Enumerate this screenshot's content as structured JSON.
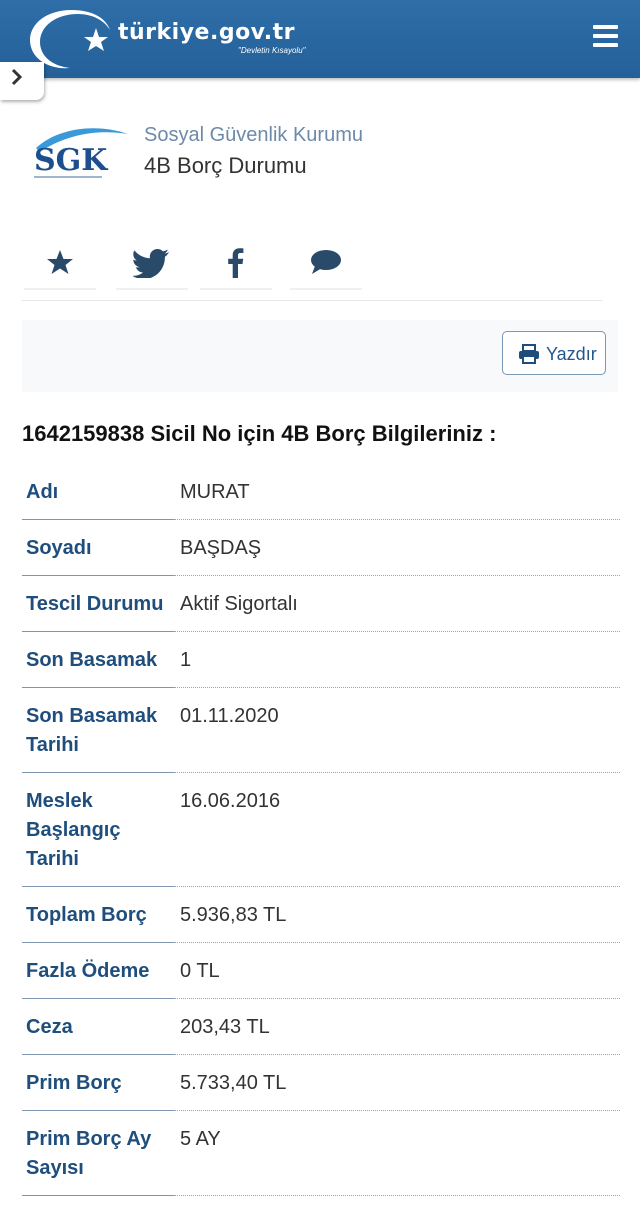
{
  "header": {
    "logo_text": "türkiye.gov.tr",
    "logo_slogan": "\"Devletin Kısayolu\""
  },
  "institution": {
    "logo_text": "SGK",
    "name": "Sosyal Güvenlik Kurumu",
    "service": "4B Borç Durumu"
  },
  "share": {
    "icons": [
      "star-icon",
      "twitter-icon",
      "facebook-icon",
      "comment-icon"
    ]
  },
  "toolbar": {
    "print_label": "Yazdır"
  },
  "info": {
    "title": "1642159838 Sicil No için 4B Borç Bilgileriniz :",
    "rows": [
      {
        "label": "Adı",
        "value": "MURAT"
      },
      {
        "label": "Soyadı",
        "value": "BAŞDAŞ"
      },
      {
        "label": "Tescil Durumu",
        "value": "Aktif Sigortalı"
      },
      {
        "label": "Son Basamak",
        "value": "1"
      },
      {
        "label": "Son Basamak Tarihi",
        "value": "01.11.2020"
      },
      {
        "label": "Meslek Başlangıç Tarihi",
        "value": "16.06.2016"
      },
      {
        "label": "Toplam Borç",
        "value": "5.936,83 TL"
      },
      {
        "label": "Fazla Ödeme",
        "value": "0 TL"
      },
      {
        "label": "Ceza",
        "value": "203,43 TL"
      },
      {
        "label": "Prim Borç",
        "value": "5.733,40 TL"
      },
      {
        "label": "Prim Borç Ay Sayısı",
        "value": "5 AY"
      }
    ]
  },
  "colors": {
    "header_bg": "#2a659f",
    "label_blue": "#1f4e7d",
    "org_grey_blue": "#6d8aa8"
  }
}
